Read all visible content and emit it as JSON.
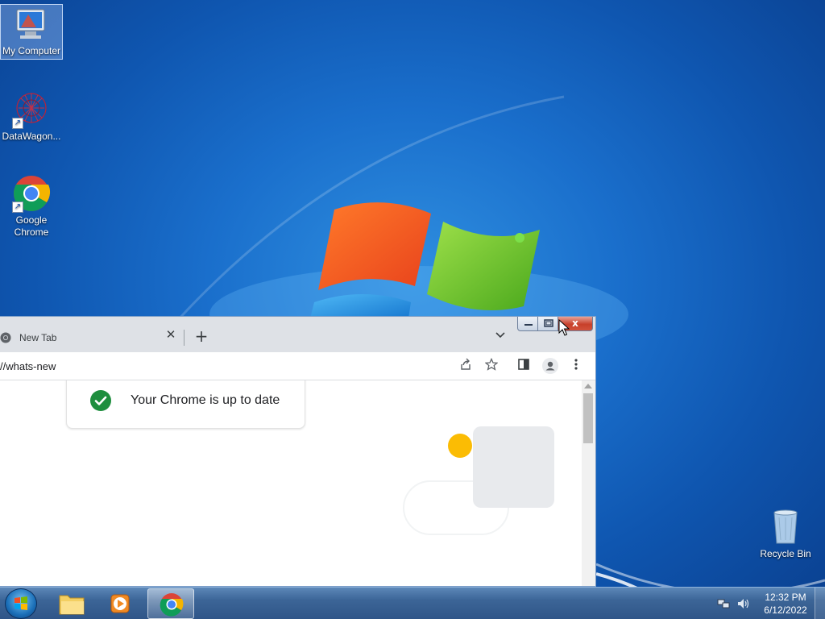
{
  "desktop": {
    "icons": [
      {
        "label": "My Computer"
      },
      {
        "label": "DataWagon..."
      },
      {
        "label_line1": "Google",
        "label_line2": "Chrome"
      },
      {
        "label": "Recycle Bin"
      }
    ]
  },
  "browser": {
    "tab": {
      "title": "New Tab",
      "close": "✕",
      "icon": "chrome-icon"
    },
    "new_tab": "+",
    "tab_search": "⌄",
    "window_controls": {
      "close": "x"
    },
    "address": "//whats-new",
    "update_message": "Your Chrome is up to date",
    "colors": {
      "check": "#1e8e3e",
      "accent_yellow": "#fbbc04"
    }
  },
  "taskbar": {
    "time": "12:32 PM",
    "date": "6/12/2022"
  }
}
